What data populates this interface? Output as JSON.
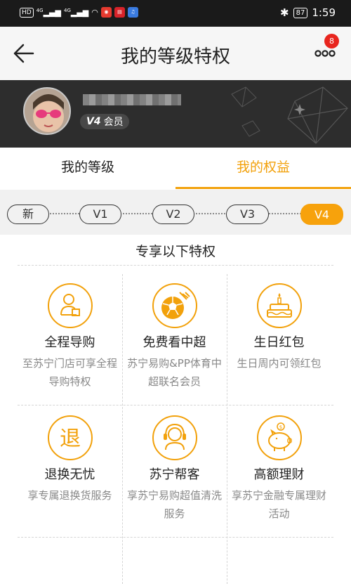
{
  "status_bar": {
    "hd": "HD",
    "net1": "4G",
    "net2": "4G",
    "battery": "87",
    "time": "1:59"
  },
  "header": {
    "title": "我的等级特权",
    "badge_count": "8"
  },
  "profile": {
    "member_level": "V4",
    "member_label": "会员"
  },
  "tabs": [
    {
      "label": "我的等级",
      "active": false
    },
    {
      "label": "我的权益",
      "active": true
    }
  ],
  "levels": [
    {
      "label": "新",
      "active": false
    },
    {
      "label": "V1",
      "active": false
    },
    {
      "label": "V2",
      "active": false
    },
    {
      "label": "V3",
      "active": false
    },
    {
      "label": "V4",
      "active": true
    }
  ],
  "section_title": "专享以下特权",
  "privileges": [
    {
      "icon": "shopping-guide-icon",
      "name": "全程导购",
      "desc": "至苏宁门店可享全程导购特权"
    },
    {
      "icon": "football-icon",
      "name": "免费看中超",
      "desc": "苏宁易购&PP体育中超联名会员"
    },
    {
      "icon": "birthday-cake-icon",
      "name": "生日红包",
      "desc": "生日周内可领红包"
    },
    {
      "icon": "return-exchange-icon",
      "name": "退换无忧",
      "desc": "享专属退换货服务"
    },
    {
      "icon": "customer-service-icon",
      "name": "苏宁帮客",
      "desc": "享苏宁易购超值清洗服务"
    },
    {
      "icon": "piggy-bank-icon",
      "name": "高额理财",
      "desc": "享苏宁金融专属理财活动"
    }
  ],
  "colors": {
    "accent": "#f2a10b",
    "banner": "#2d2d2d",
    "badge": "#e8251e"
  }
}
